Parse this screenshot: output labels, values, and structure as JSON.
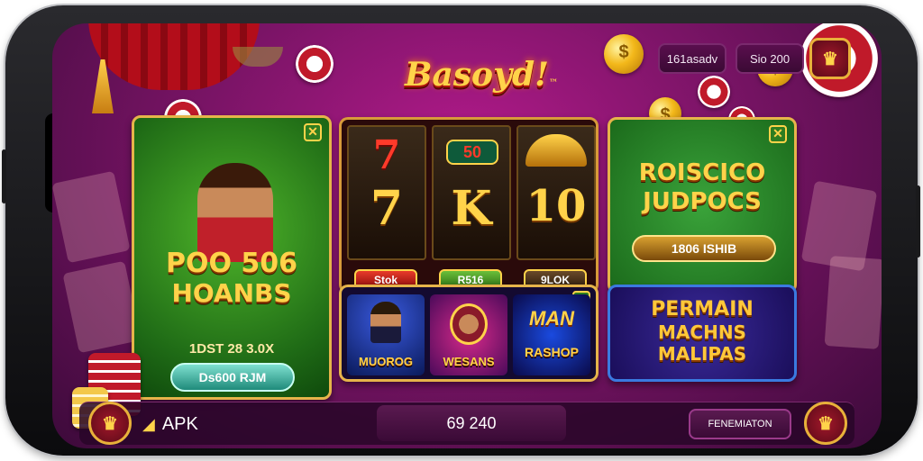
{
  "app": {
    "logo_text": "Basoyd!",
    "logo_mark": "™"
  },
  "header": {
    "pill_left": "161asadv",
    "pill_right": "Sio 200",
    "menu_icon": "crown-badge-icon"
  },
  "featured_card": {
    "title_line1": "POO 506",
    "title_line2": "HOANBS",
    "subtitle": "1DST 28 3.0X",
    "button": "Ds600 RJM",
    "close_icon": "close-icon"
  },
  "slot_card": {
    "badge": "50",
    "reels": [
      "7",
      "7",
      "K",
      "10"
    ],
    "buttons": [
      "Stok",
      "R516",
      "9LOK"
    ],
    "close_icon": "close-icon"
  },
  "promo_card": {
    "title_line1": "ROISCICO",
    "title_line2": "JUDPOCS",
    "button": "1806 ISHIB",
    "close_icon": "close-icon"
  },
  "games_card": {
    "tiles": [
      {
        "label": "MUOROG"
      },
      {
        "label": "WESANS"
      },
      {
        "label": "RASHOP",
        "header": "MAN"
      }
    ],
    "close_icon": "close-icon"
  },
  "purple_card": {
    "line1": "PERMAIN",
    "line2": "MACHNS",
    "line3": "MALIPAS"
  },
  "bottom_bar": {
    "apk_label": "APK",
    "apk_icon": "triangle-icon",
    "center_value": "69 240",
    "right_button": "FENEMIATON",
    "left_badge_icon": "crown-badge-icon",
    "right_badge_icon": "crown-badge-icon"
  },
  "colors": {
    "background": "#7a1466",
    "gold": "#ffd34a",
    "card_green": "#1f6b16",
    "card_purple": "#1a0e5a"
  }
}
